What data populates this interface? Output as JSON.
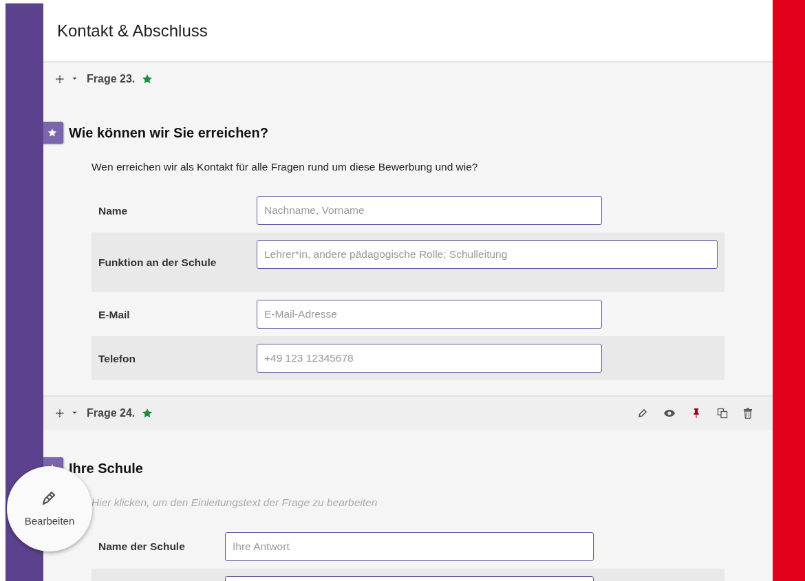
{
  "page": {
    "title": "Kontakt & Abschluss"
  },
  "questions": [
    {
      "number": "Frage 23.",
      "required": true,
      "title": "Wie können wir Sie erreichen?",
      "intro": {
        "text": "Wen erreichen wir als Kontakt für alle Fragen rund um diese Bewerbung und wie?",
        "is_placeholder": false
      },
      "rows": [
        {
          "label": "Name",
          "placeholder": "Nachname, Vorname",
          "wide": false
        },
        {
          "label": "Funktion an der Schule",
          "placeholder": "Lehrer*in, andere pädagogische Rolle; Schulleitung",
          "shaded": true,
          "wide": true
        },
        {
          "label": "E-Mail",
          "placeholder": "E-Mail-Adresse",
          "wide": false
        },
        {
          "label": "Telefon",
          "placeholder": "+49 123 12345678",
          "shaded": true,
          "wide": false
        }
      ]
    },
    {
      "number": "Frage 24.",
      "required": true,
      "show_tools": true,
      "pinned": true,
      "title": "Ihre Schule",
      "intro": {
        "text": "Hier klicken, um den Einleitungstext der Frage zu bearbeiten",
        "is_placeholder": true
      },
      "rows": [
        {
          "label": "Name der Schule",
          "placeholder": "Ihre Antwort",
          "wide": false
        },
        {
          "shaded": true,
          "wide": false
        }
      ]
    }
  ],
  "edit_button": {
    "label": "Bearbeiten"
  }
}
